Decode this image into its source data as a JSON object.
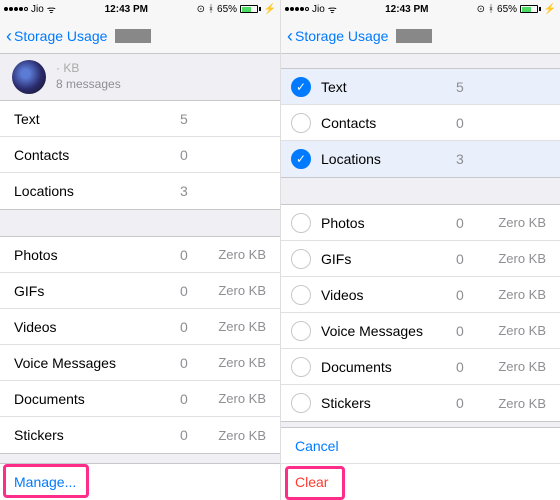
{
  "status": {
    "carrier": "Jio",
    "time": "12:43 PM",
    "battery_pct": "65%"
  },
  "nav": {
    "back": "Storage Usage"
  },
  "left": {
    "header_line1": "· KB",
    "header_line2": "8 messages",
    "group1": [
      {
        "label": "Text",
        "count": "5"
      },
      {
        "label": "Contacts",
        "count": "0"
      },
      {
        "label": "Locations",
        "count": "3"
      }
    ],
    "group2": [
      {
        "label": "Photos",
        "count": "0",
        "size": "Zero KB"
      },
      {
        "label": "GIFs",
        "count": "0",
        "size": "Zero KB"
      },
      {
        "label": "Videos",
        "count": "0",
        "size": "Zero KB"
      },
      {
        "label": "Voice Messages",
        "count": "0",
        "size": "Zero KB"
      },
      {
        "label": "Documents",
        "count": "0",
        "size": "Zero KB"
      },
      {
        "label": "Stickers",
        "count": "0",
        "size": "Zero KB"
      }
    ],
    "manage": "Manage..."
  },
  "right": {
    "group1": [
      {
        "label": "Text",
        "count": "5",
        "selected": true
      },
      {
        "label": "Contacts",
        "count": "0",
        "selected": false
      },
      {
        "label": "Locations",
        "count": "3",
        "selected": true
      }
    ],
    "group2": [
      {
        "label": "Photos",
        "count": "0",
        "size": "Zero KB"
      },
      {
        "label": "GIFs",
        "count": "0",
        "size": "Zero KB"
      },
      {
        "label": "Videos",
        "count": "0",
        "size": "Zero KB"
      },
      {
        "label": "Voice Messages",
        "count": "0",
        "size": "Zero KB"
      },
      {
        "label": "Documents",
        "count": "0",
        "size": "Zero KB"
      },
      {
        "label": "Stickers",
        "count": "0",
        "size": "Zero KB"
      }
    ],
    "cancel": "Cancel",
    "clear": "Clear"
  }
}
